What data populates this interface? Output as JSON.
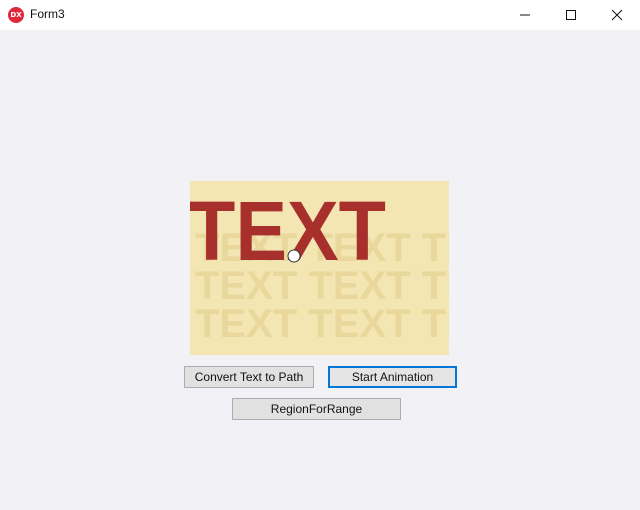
{
  "window": {
    "title": "Form3",
    "app_icon_text": "DX",
    "app_icon_color": "#e0283c",
    "controls": [
      "minimize-icon",
      "maximize-icon",
      "close-icon"
    ]
  },
  "canvas": {
    "background": "#f3e6b3",
    "text": "TEXT",
    "text_color": "#a8302c",
    "ghost_color": "#e9d79c",
    "ghost_rows": [
      "ТEXT ТEXT ТEXT",
      "ТEXT ТEXT ТEXT",
      "ТEXT ТEXT ТEXT"
    ]
  },
  "buttons": {
    "convert": "Convert Text to Path",
    "start": "Start Animation",
    "region": "RegionForRange"
  }
}
